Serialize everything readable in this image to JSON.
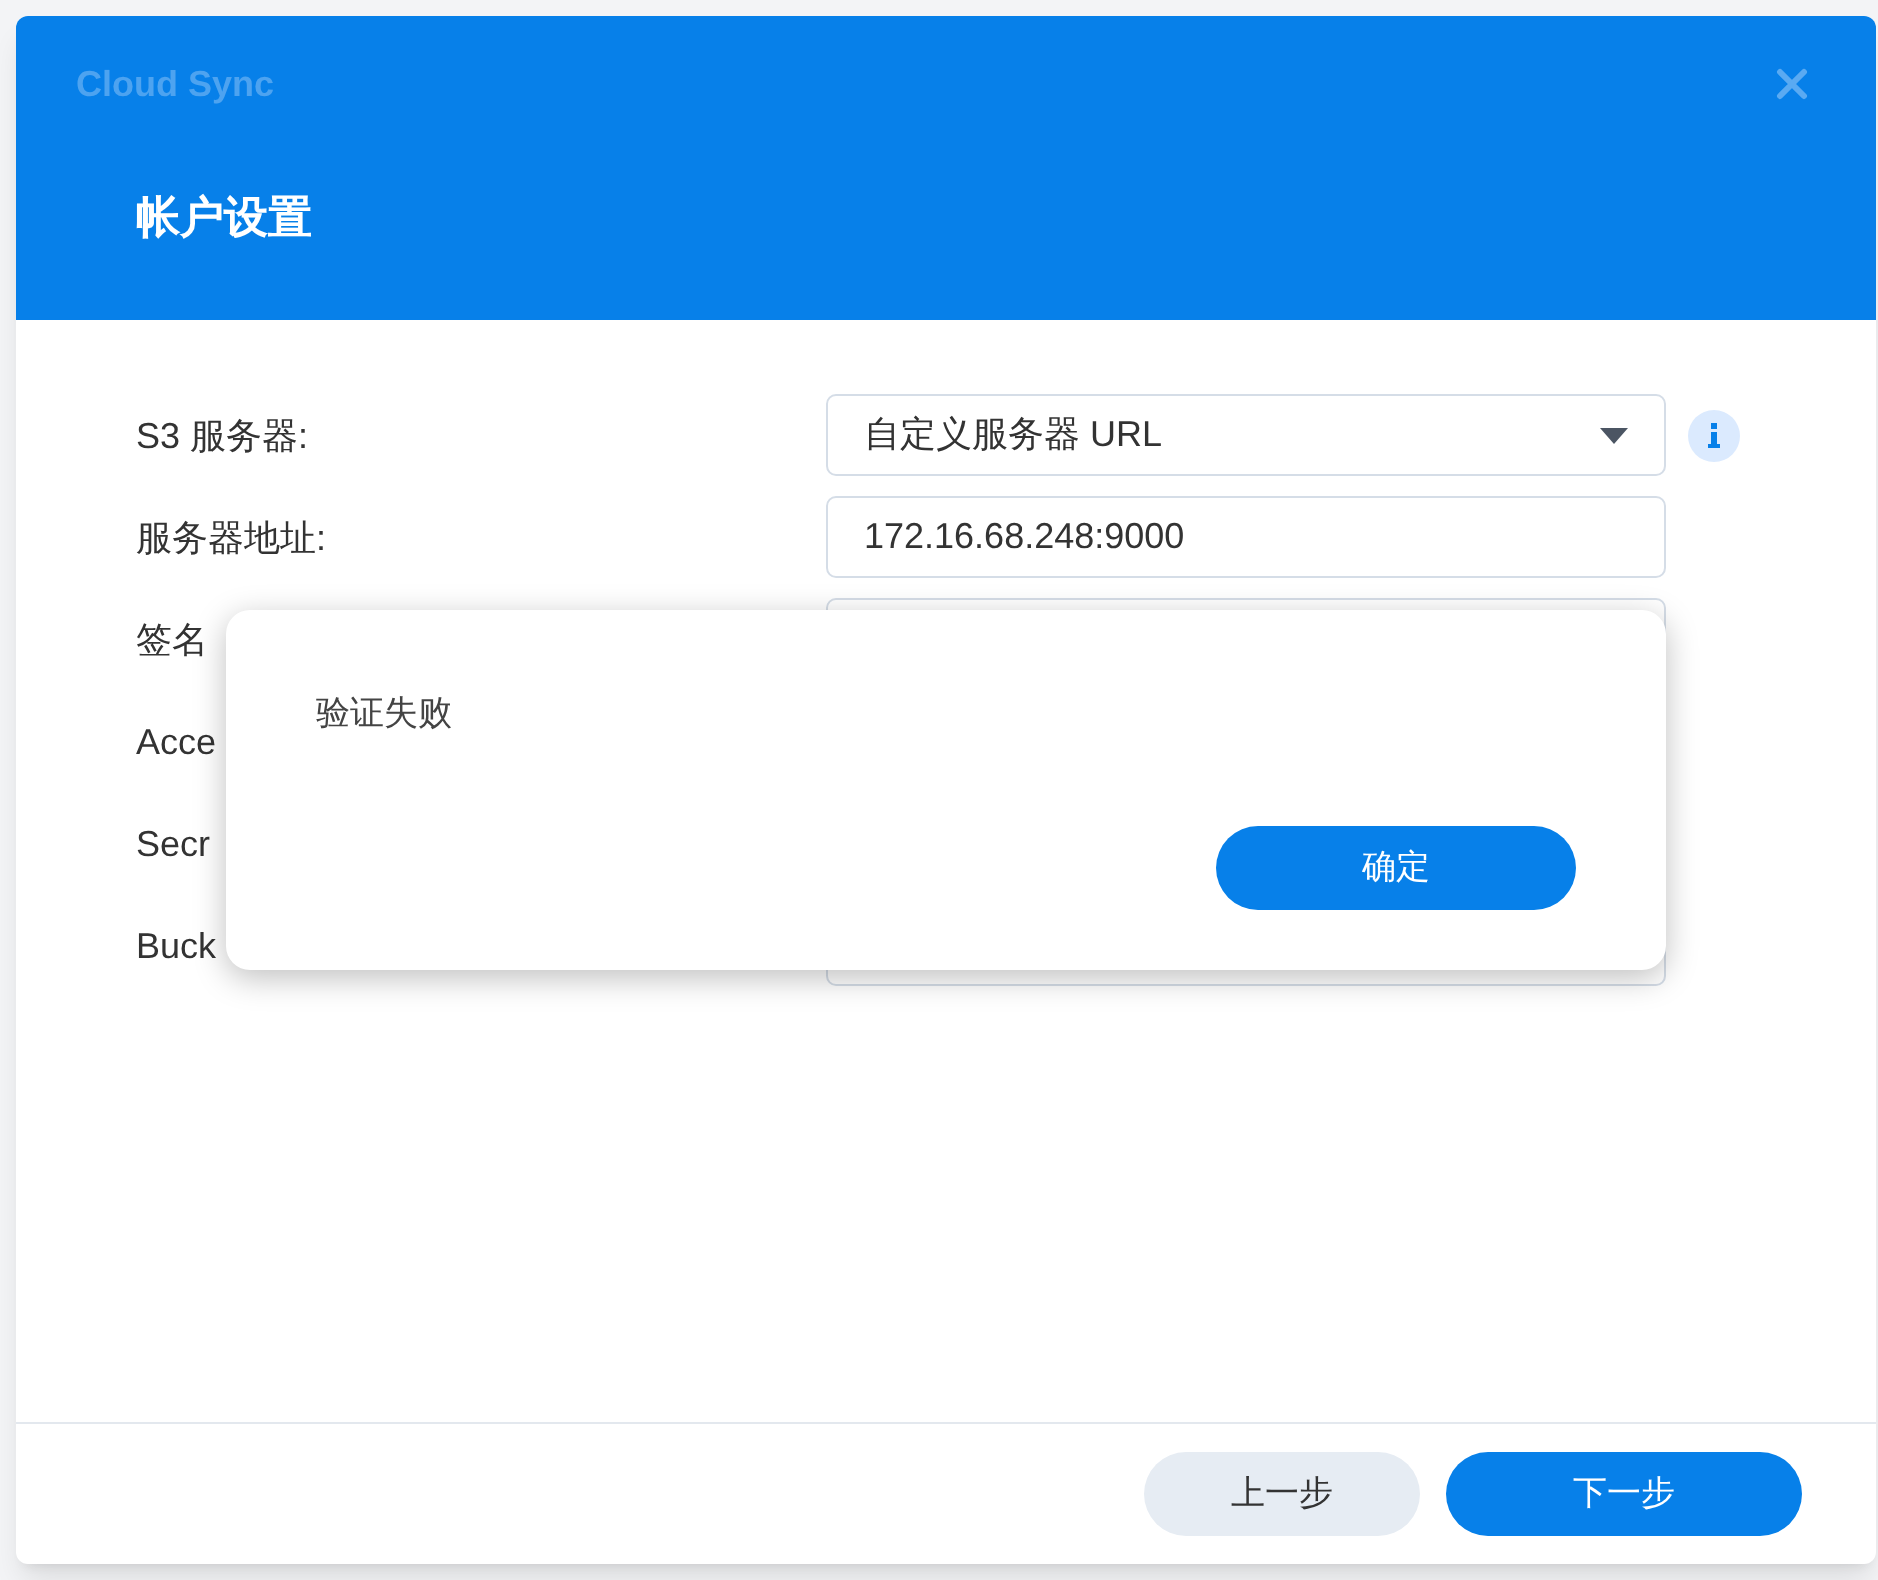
{
  "window": {
    "title": "Cloud Sync"
  },
  "header": {
    "title": "帐户设置"
  },
  "form": {
    "fields": [
      {
        "label": "S3 服务器:",
        "kind": "dropdown",
        "value": "自定义服务器 URL",
        "info": true
      },
      {
        "label": "服务器地址:",
        "kind": "text",
        "value": "172.16.68.248:9000"
      },
      {
        "label": "签名",
        "kind": "text"
      },
      {
        "label": "Acce",
        "kind": "label"
      },
      {
        "label": "Secr",
        "kind": "label"
      },
      {
        "label": "Buck",
        "kind": "text"
      }
    ]
  },
  "alert": {
    "message": "验证失败",
    "button": "确定"
  },
  "footer": {
    "buttons": [
      {
        "label": "上一步",
        "kind": "secondary"
      },
      {
        "label": "下一步",
        "kind": "primary"
      }
    ]
  }
}
